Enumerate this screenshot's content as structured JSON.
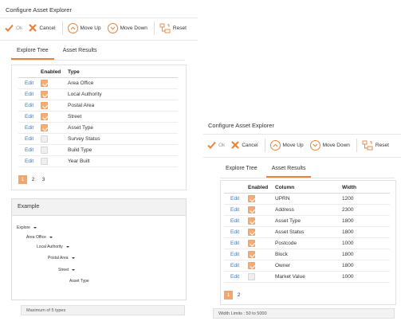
{
  "left": {
    "title": "Configure Asset Explorer",
    "toolbar": {
      "ok": "Ok",
      "cancel": "Cancel",
      "move_up": "Move Up",
      "move_down": "Move Down",
      "reset": "Reset"
    },
    "tabs": [
      "Explore Tree",
      "Asset Results"
    ],
    "active_tab": 0,
    "headers": [
      "",
      "Enabled",
      "Type"
    ],
    "rows": [
      {
        "edit": "Edit",
        "enabled": true,
        "type": "Area Office"
      },
      {
        "edit": "Edit",
        "enabled": true,
        "type": "Local Authority"
      },
      {
        "edit": "Edit",
        "enabled": true,
        "type": "Postal Area"
      },
      {
        "edit": "Edit",
        "enabled": true,
        "type": "Street"
      },
      {
        "edit": "Edit",
        "enabled": true,
        "type": "Asset Type"
      },
      {
        "edit": "Edit",
        "enabled": false,
        "type": "Survey Status"
      },
      {
        "edit": "Edit",
        "enabled": false,
        "type": "Build Type"
      },
      {
        "edit": "Edit",
        "enabled": false,
        "type": "Year Built"
      }
    ],
    "pages": [
      "1",
      "2",
      "3"
    ],
    "active_page": 0,
    "example": {
      "title": "Example",
      "nodes": [
        "Explore",
        "Area Office",
        "Local Authority",
        "Postal Area",
        "Street",
        "Asset Type"
      ]
    },
    "note": "Maximum of 5 types"
  },
  "right": {
    "title": "Configure Asset Explorer",
    "toolbar": {
      "ok": "Ok",
      "cancel": "Cancel",
      "move_up": "Move Up",
      "move_down": "Move Down",
      "reset": "Reset"
    },
    "tabs": [
      "Explore Tree",
      "Asset Results"
    ],
    "active_tab": 1,
    "headers": [
      "",
      "Enabled",
      "Column",
      "Width"
    ],
    "rows": [
      {
        "edit": "Edit",
        "enabled": true,
        "column": "UPRN",
        "width": "1200"
      },
      {
        "edit": "Edit",
        "enabled": true,
        "column": "Address",
        "width": "2300"
      },
      {
        "edit": "Edit",
        "enabled": true,
        "column": "Asset Type",
        "width": "1800"
      },
      {
        "edit": "Edit",
        "enabled": true,
        "column": "Asset Status",
        "width": "1800"
      },
      {
        "edit": "Edit",
        "enabled": true,
        "column": "Postcode",
        "width": "1000"
      },
      {
        "edit": "Edit",
        "enabled": true,
        "column": "Block",
        "width": "1800"
      },
      {
        "edit": "Edit",
        "enabled": true,
        "column": "Owner",
        "width": "1800"
      },
      {
        "edit": "Edit",
        "enabled": false,
        "column": "Market Value",
        "width": "1000"
      }
    ],
    "pages": [
      "1",
      "2"
    ],
    "active_page": 0,
    "note": "Width Limits : 50 to 5000"
  },
  "colors": {
    "accent": "#e8833a",
    "check": "#f5ab74",
    "link": "#3a78c2"
  },
  "icons": [
    "check-icon",
    "x-icon",
    "arrow-up-icon",
    "arrow-down-icon",
    "reset-icon"
  ]
}
